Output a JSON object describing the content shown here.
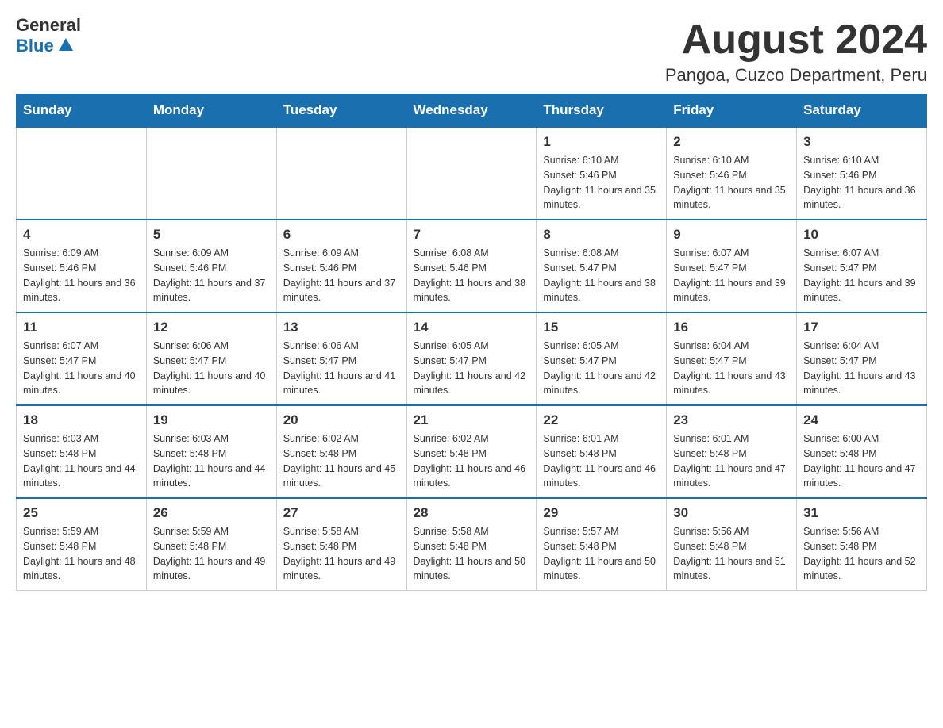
{
  "header": {
    "logo_general": "General",
    "logo_blue": "Blue",
    "month_title": "August 2024",
    "location": "Pangoa, Cuzco Department, Peru"
  },
  "days_of_week": [
    "Sunday",
    "Monday",
    "Tuesday",
    "Wednesday",
    "Thursday",
    "Friday",
    "Saturday"
  ],
  "weeks": [
    [
      {
        "day": "",
        "info": ""
      },
      {
        "day": "",
        "info": ""
      },
      {
        "day": "",
        "info": ""
      },
      {
        "day": "",
        "info": ""
      },
      {
        "day": "1",
        "info": "Sunrise: 6:10 AM\nSunset: 5:46 PM\nDaylight: 11 hours and 35 minutes."
      },
      {
        "day": "2",
        "info": "Sunrise: 6:10 AM\nSunset: 5:46 PM\nDaylight: 11 hours and 35 minutes."
      },
      {
        "day": "3",
        "info": "Sunrise: 6:10 AM\nSunset: 5:46 PM\nDaylight: 11 hours and 36 minutes."
      }
    ],
    [
      {
        "day": "4",
        "info": "Sunrise: 6:09 AM\nSunset: 5:46 PM\nDaylight: 11 hours and 36 minutes."
      },
      {
        "day": "5",
        "info": "Sunrise: 6:09 AM\nSunset: 5:46 PM\nDaylight: 11 hours and 37 minutes."
      },
      {
        "day": "6",
        "info": "Sunrise: 6:09 AM\nSunset: 5:46 PM\nDaylight: 11 hours and 37 minutes."
      },
      {
        "day": "7",
        "info": "Sunrise: 6:08 AM\nSunset: 5:46 PM\nDaylight: 11 hours and 38 minutes."
      },
      {
        "day": "8",
        "info": "Sunrise: 6:08 AM\nSunset: 5:47 PM\nDaylight: 11 hours and 38 minutes."
      },
      {
        "day": "9",
        "info": "Sunrise: 6:07 AM\nSunset: 5:47 PM\nDaylight: 11 hours and 39 minutes."
      },
      {
        "day": "10",
        "info": "Sunrise: 6:07 AM\nSunset: 5:47 PM\nDaylight: 11 hours and 39 minutes."
      }
    ],
    [
      {
        "day": "11",
        "info": "Sunrise: 6:07 AM\nSunset: 5:47 PM\nDaylight: 11 hours and 40 minutes."
      },
      {
        "day": "12",
        "info": "Sunrise: 6:06 AM\nSunset: 5:47 PM\nDaylight: 11 hours and 40 minutes."
      },
      {
        "day": "13",
        "info": "Sunrise: 6:06 AM\nSunset: 5:47 PM\nDaylight: 11 hours and 41 minutes."
      },
      {
        "day": "14",
        "info": "Sunrise: 6:05 AM\nSunset: 5:47 PM\nDaylight: 11 hours and 42 minutes."
      },
      {
        "day": "15",
        "info": "Sunrise: 6:05 AM\nSunset: 5:47 PM\nDaylight: 11 hours and 42 minutes."
      },
      {
        "day": "16",
        "info": "Sunrise: 6:04 AM\nSunset: 5:47 PM\nDaylight: 11 hours and 43 minutes."
      },
      {
        "day": "17",
        "info": "Sunrise: 6:04 AM\nSunset: 5:47 PM\nDaylight: 11 hours and 43 minutes."
      }
    ],
    [
      {
        "day": "18",
        "info": "Sunrise: 6:03 AM\nSunset: 5:48 PM\nDaylight: 11 hours and 44 minutes."
      },
      {
        "day": "19",
        "info": "Sunrise: 6:03 AM\nSunset: 5:48 PM\nDaylight: 11 hours and 44 minutes."
      },
      {
        "day": "20",
        "info": "Sunrise: 6:02 AM\nSunset: 5:48 PM\nDaylight: 11 hours and 45 minutes."
      },
      {
        "day": "21",
        "info": "Sunrise: 6:02 AM\nSunset: 5:48 PM\nDaylight: 11 hours and 46 minutes."
      },
      {
        "day": "22",
        "info": "Sunrise: 6:01 AM\nSunset: 5:48 PM\nDaylight: 11 hours and 46 minutes."
      },
      {
        "day": "23",
        "info": "Sunrise: 6:01 AM\nSunset: 5:48 PM\nDaylight: 11 hours and 47 minutes."
      },
      {
        "day": "24",
        "info": "Sunrise: 6:00 AM\nSunset: 5:48 PM\nDaylight: 11 hours and 47 minutes."
      }
    ],
    [
      {
        "day": "25",
        "info": "Sunrise: 5:59 AM\nSunset: 5:48 PM\nDaylight: 11 hours and 48 minutes."
      },
      {
        "day": "26",
        "info": "Sunrise: 5:59 AM\nSunset: 5:48 PM\nDaylight: 11 hours and 49 minutes."
      },
      {
        "day": "27",
        "info": "Sunrise: 5:58 AM\nSunset: 5:48 PM\nDaylight: 11 hours and 49 minutes."
      },
      {
        "day": "28",
        "info": "Sunrise: 5:58 AM\nSunset: 5:48 PM\nDaylight: 11 hours and 50 minutes."
      },
      {
        "day": "29",
        "info": "Sunrise: 5:57 AM\nSunset: 5:48 PM\nDaylight: 11 hours and 50 minutes."
      },
      {
        "day": "30",
        "info": "Sunrise: 5:56 AM\nSunset: 5:48 PM\nDaylight: 11 hours and 51 minutes."
      },
      {
        "day": "31",
        "info": "Sunrise: 5:56 AM\nSunset: 5:48 PM\nDaylight: 11 hours and 52 minutes."
      }
    ]
  ]
}
